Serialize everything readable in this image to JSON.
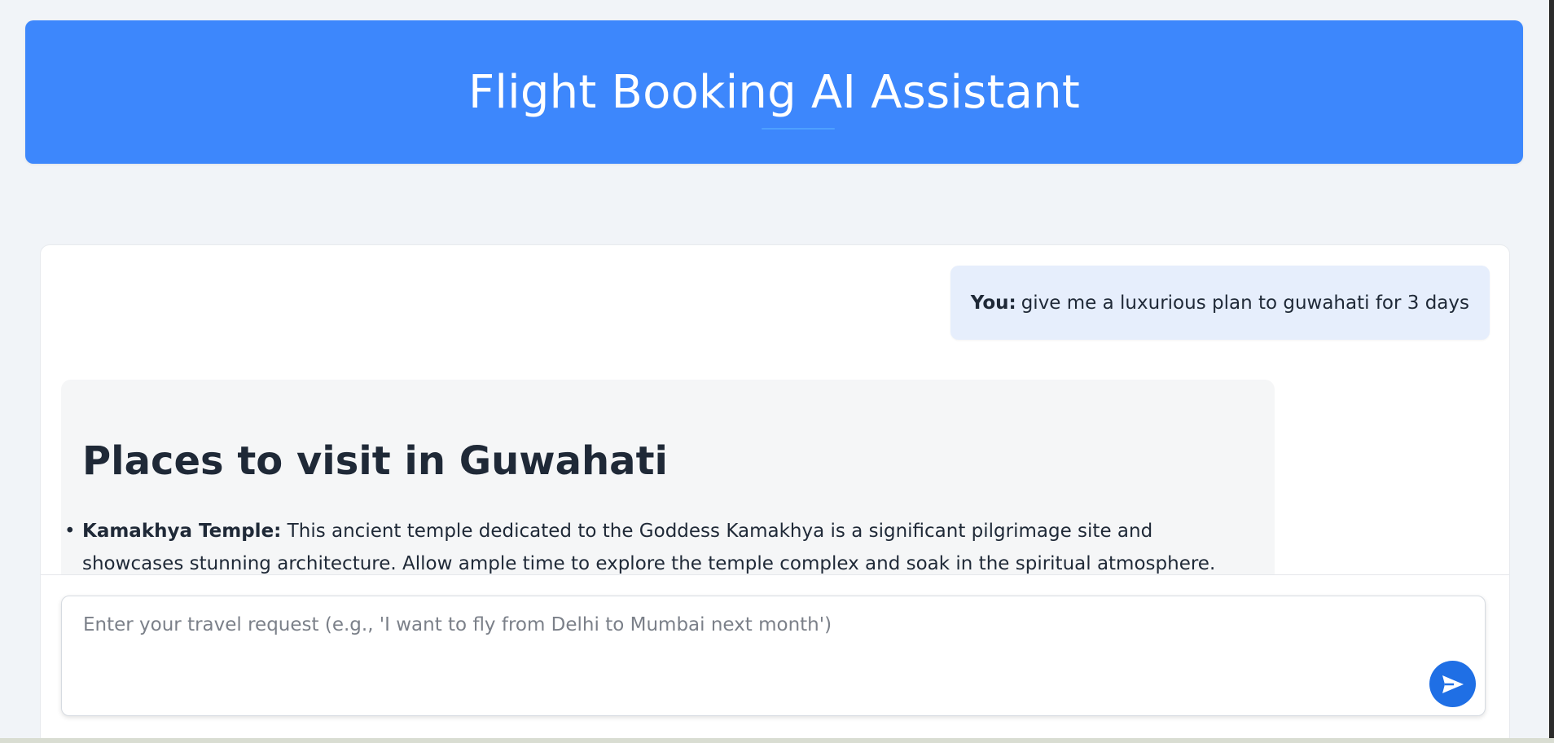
{
  "header": {
    "title": "Flight Booking AI Assistant"
  },
  "chat": {
    "user_message": {
      "sender": "You:",
      "text": "give me a luxurious plan to guwahati for 3 days"
    },
    "bot_message": {
      "heading": "Places to visit in Guwahati",
      "items": [
        {
          "bullet": "•",
          "title": "Kamakhya Temple:",
          "text": " This ancient temple dedicated to the Goddess Kamakhya is a significant pilgrimage site and showcases stunning architecture. Allow ample time to explore the temple complex and soak in the spiritual atmosphere."
        }
      ]
    }
  },
  "input": {
    "placeholder": "Enter your travel request (e.g., 'I want to fly from Delhi to Mumbai next month')",
    "value": ""
  },
  "colors": {
    "header_bg": "#3d87fc",
    "send_button": "#1f6fe5",
    "user_bubble": "#e6eefc",
    "bot_bubble": "#f5f6f7"
  },
  "icons": {
    "send": "send-icon"
  }
}
